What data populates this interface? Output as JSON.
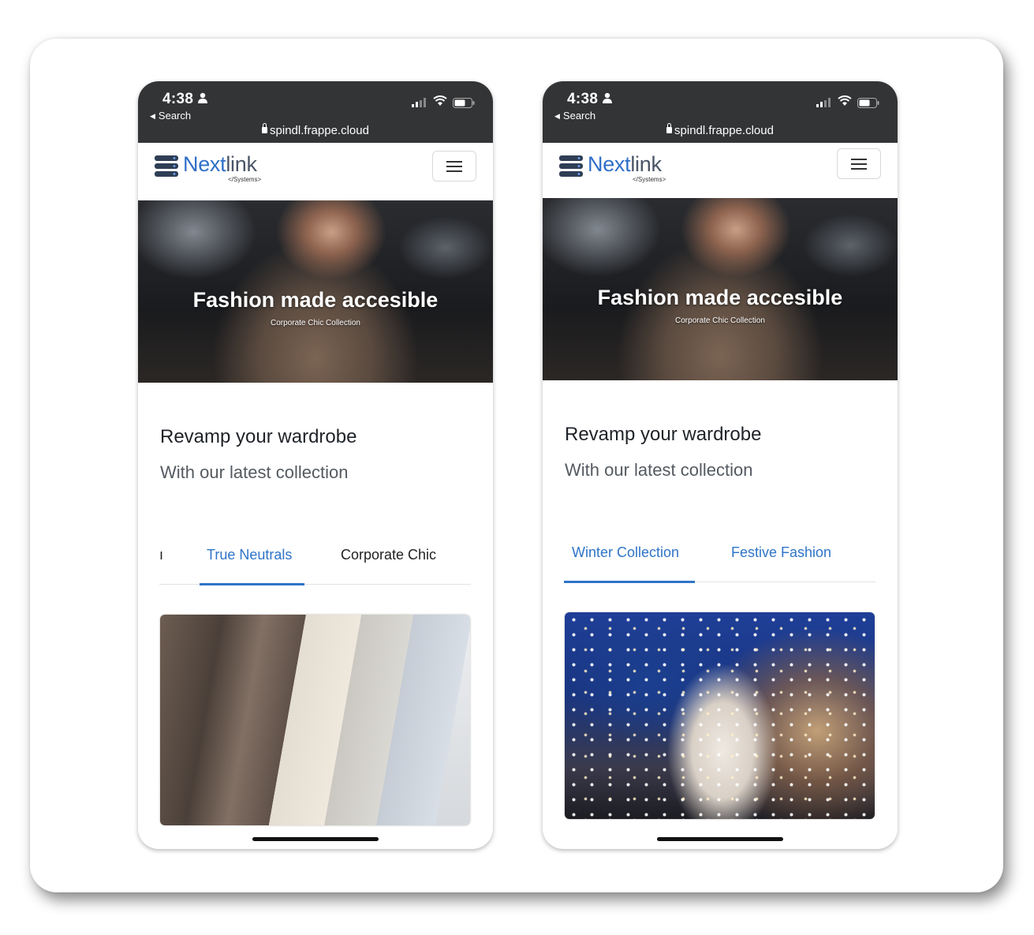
{
  "status_bar": {
    "time": "4:38",
    "back_label": "Search",
    "url": "spindl.frappe.cloud",
    "icons": [
      "person-icon",
      "signal-icon",
      "wifi-icon",
      "battery-icon",
      "lock-icon"
    ]
  },
  "brand": {
    "name_primary": "Next",
    "name_secondary": "link",
    "tagline": "</Systems>",
    "primary_color": "#2f6fc7",
    "secondary_color": "#4a5566"
  },
  "hero": {
    "title": "Fashion made accesible",
    "subtitle": "Corporate Chic Collection"
  },
  "intro": {
    "title": "Revamp your wardrobe",
    "subtitle": "With our latest collection"
  },
  "left_phone": {
    "tabs": [
      {
        "label": "ı",
        "active": false
      },
      {
        "label": "True Neutrals",
        "active": true
      },
      {
        "label": "Corporate Chic",
        "active": false
      }
    ]
  },
  "right_phone": {
    "tabs": [
      {
        "label": "Winter Collection",
        "active": true
      },
      {
        "label": "Festive Fashion",
        "active": false
      }
    ]
  },
  "colors": {
    "accent": "#2f74c8",
    "status_bar_bg": "#333436"
  }
}
